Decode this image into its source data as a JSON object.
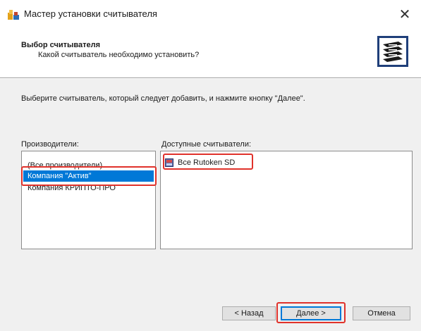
{
  "window": {
    "title": "Мастер установки считывателя"
  },
  "header": {
    "title": "Выбор считывателя",
    "subtitle": "Какой считыватель необходимо установить?"
  },
  "instruction": "Выберите считыватель, который следует добавить, и нажмите кнопку \"Далее\".",
  "manufacturers": {
    "label": "Производители:",
    "items": [
      "(Все производители)",
      "Компания \"Актив\"",
      "Компания КРИПТО-ПРО"
    ],
    "selected": 1
  },
  "readers": {
    "label": "Доступные считыватели:",
    "items": [
      "Все Rutoken SD"
    ]
  },
  "buttons": {
    "back": "< Назад",
    "next": "Далее >",
    "cancel": "Отмена"
  },
  "colors": {
    "selection": "#0078d7",
    "highlight": "#e0322b",
    "default_button_border": "#0078d7"
  },
  "icons": {
    "app": "wizard-app-icon",
    "header": "card-reader-stack-icon",
    "reader": "reader-device-icon",
    "close": "close-icon"
  }
}
